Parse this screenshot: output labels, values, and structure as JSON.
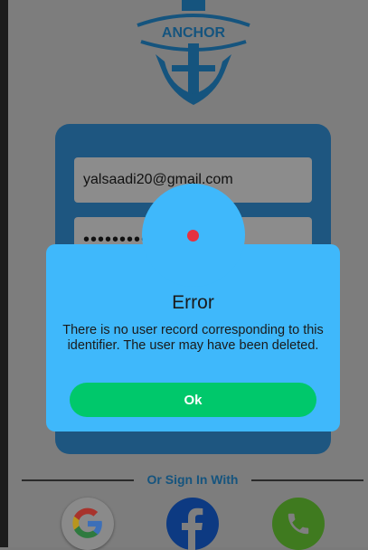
{
  "logo": {
    "text": "ANCHOR",
    "color": "#15547e"
  },
  "form": {
    "email_value": "yalsaadi20@gmail.com",
    "password_value": "•••••••••"
  },
  "divider": {
    "label": "Or Sign In With"
  },
  "social": {
    "google_icon": "google-logo-icon",
    "facebook_icon": "facebook-logo-icon",
    "phone_icon": "phone-icon"
  },
  "dialog": {
    "title": "Error",
    "message": "There is no user record corresponding to this identifier. The user may have been deleted.",
    "ok_label": "Ok",
    "accent": "#3fb8fb",
    "button_color": "#00c86b"
  }
}
